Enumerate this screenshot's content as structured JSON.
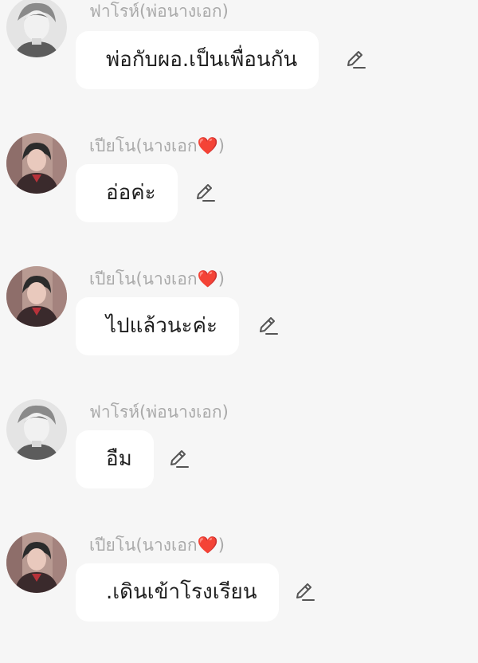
{
  "messages": [
    {
      "sender": "ฟาโรห์(พ่อนางเอก)",
      "text": "พ่อกับผอ.เป็นเพื่อนกัน",
      "avatar": "male-character-avatar"
    },
    {
      "sender": "เปียโน(นางเอก❤️)",
      "text": "อ่อค่ะ",
      "avatar": "female-character-avatar"
    },
    {
      "sender": "เปียโน(นางเอก❤️)",
      "text": "ไปแล้วนะค่ะ",
      "avatar": "female-character-avatar"
    },
    {
      "sender": "ฟาโรห์(พ่อนางเอก)",
      "text": "อืม",
      "avatar": "male-character-avatar"
    },
    {
      "sender": "เปียโน(นางเอก❤️)",
      "text": ".เดินเข้าโรงเรียน",
      "avatar": "female-character-avatar"
    }
  ],
  "icons": {
    "edit": "pencil-edit-icon"
  }
}
